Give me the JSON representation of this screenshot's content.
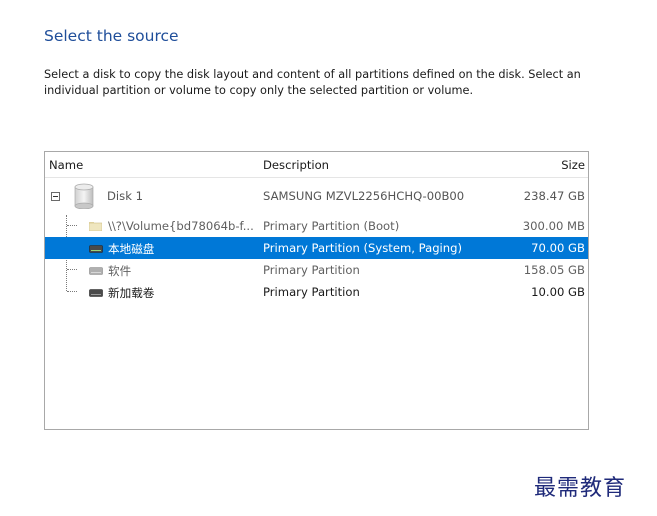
{
  "page": {
    "title": "Select the source",
    "description": "Select a disk to copy the disk layout and content of all partitions defined on the disk. Select an individual partition or volume to copy only the selected partition or volume."
  },
  "tree": {
    "columns": {
      "name": "Name",
      "description": "Description",
      "size": "Size"
    },
    "disk": {
      "name": "Disk 1",
      "description": "SAMSUNG MZVL2256HCHQ-00B00",
      "size": "238.47 GB",
      "expanded": true,
      "icon": "disk-icon"
    },
    "partitions": [
      {
        "name": "\\\\?\\Volume{bd78064b-f...",
        "description": "Primary Partition (Boot)",
        "size": "300.00 MB",
        "icon": "folder-icon",
        "selected": false
      },
      {
        "name": "本地磁盘",
        "description": "Primary Partition (System, Paging)",
        "size": "70.00 GB",
        "icon": "drive-icon",
        "selected": true
      },
      {
        "name": "软件",
        "description": "Primary Partition",
        "size": "158.05 GB",
        "icon": "drive-icon",
        "selected": false
      },
      {
        "name": "新加载卷",
        "description": "Primary Partition",
        "size": "10.00 GB",
        "icon": "drive-icon",
        "selected": false
      }
    ]
  },
  "watermark": "最需教育",
  "colors": {
    "accent": "#0078d7",
    "title": "#1f4e9a"
  }
}
